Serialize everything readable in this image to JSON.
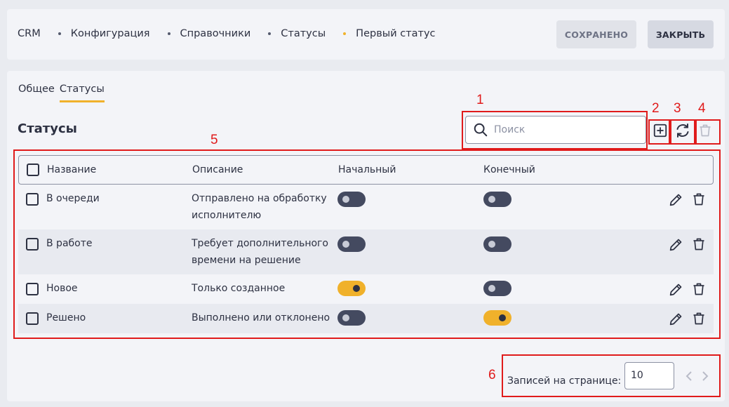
{
  "breadcrumb": [
    "CRM",
    "Конфигурация",
    "Справочники",
    "Статусы",
    "Первый статус"
  ],
  "header": {
    "saved_label": "СОХРАНЕНО",
    "close_label": "ЗАКРЫТЬ"
  },
  "tabs": [
    {
      "label": "Общее",
      "active": false
    },
    {
      "label": "Статусы",
      "active": true
    }
  ],
  "section_title": "Статусы",
  "search": {
    "placeholder": "Поиск",
    "value": ""
  },
  "annotations": [
    "1",
    "2",
    "3",
    "4",
    "5",
    "6"
  ],
  "table": {
    "headers": [
      "Название",
      "Описание",
      "Начальный",
      "Конечный"
    ],
    "rows": [
      {
        "name": "В очереди",
        "desc_line1": "Отправлено на обработку",
        "desc_line2": "исполнителю",
        "initial": false,
        "final": false
      },
      {
        "name": "В работе",
        "desc_line1": "Требует дополнительного",
        "desc_line2": "времени на решение",
        "initial": false,
        "final": false
      },
      {
        "name": "Новое",
        "desc_line1": "Только созданное",
        "desc_line2": "",
        "initial": true,
        "final": false
      },
      {
        "name": "Решено",
        "desc_line1": "Выполнено или отклонено",
        "desc_line2": "",
        "initial": false,
        "final": true
      }
    ]
  },
  "pagination": {
    "label": "Записей на странице:",
    "page_size": "10"
  },
  "icons": {
    "search": "search-icon",
    "add": "add-square-icon",
    "refresh": "refresh-icon",
    "delete": "trash-icon",
    "edit": "pencil-icon",
    "prev": "chevron-left-icon",
    "next": "chevron-right-icon"
  },
  "colors": {
    "accent": "#f0b12b",
    "annotation": "#e01b1b",
    "toggle_off": "#444a60"
  }
}
